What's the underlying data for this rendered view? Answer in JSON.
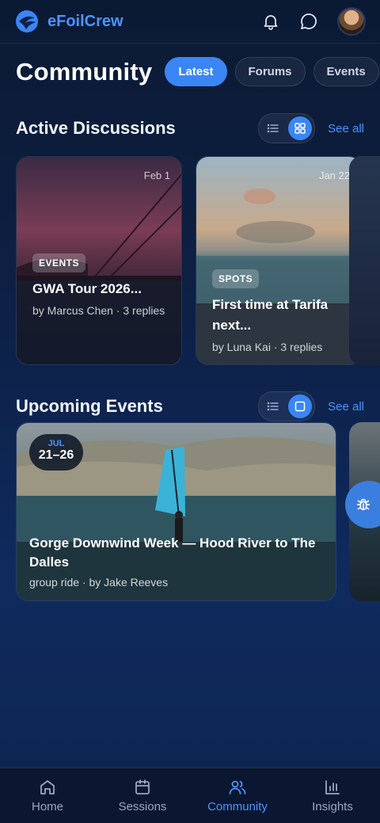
{
  "app": {
    "brand": "eFoilCrew"
  },
  "header": {
    "title": "Community"
  },
  "tabs": [
    {
      "label": "Latest",
      "active": true
    },
    {
      "label": "Forums",
      "active": false
    },
    {
      "label": "Events",
      "active": false
    }
  ],
  "discussions": {
    "title": "Active Discussions",
    "see_all": "See all",
    "view": "grid",
    "items": [
      {
        "date": "Feb 1",
        "badge": "EVENTS",
        "title": "GWA Tour 2026...",
        "meta": "by Marcus Chen · 3 replies"
      },
      {
        "date": "Jan 22",
        "badge": "SPOTS",
        "title": "First time at Tarifa next...",
        "meta": "by Luna Kai · 3 replies"
      }
    ]
  },
  "events": {
    "title": "Upcoming Events",
    "see_all": "See all",
    "view": "single",
    "items": [
      {
        "month": "JUL",
        "days": "21–26",
        "title": "Gorge Downwind Week — Hood River to The Dalles",
        "meta": "group ride · by Jake Reeves"
      }
    ]
  },
  "nav": [
    {
      "label": "Home",
      "icon": "home-icon",
      "active": false
    },
    {
      "label": "Sessions",
      "icon": "calendar-icon",
      "active": false
    },
    {
      "label": "Community",
      "icon": "users-icon",
      "active": true
    },
    {
      "label": "Insights",
      "icon": "bar-chart-icon",
      "active": false
    }
  ],
  "colors": {
    "accent": "#3a86f5",
    "brand": "#4d94ff",
    "background": "#0d2147"
  }
}
